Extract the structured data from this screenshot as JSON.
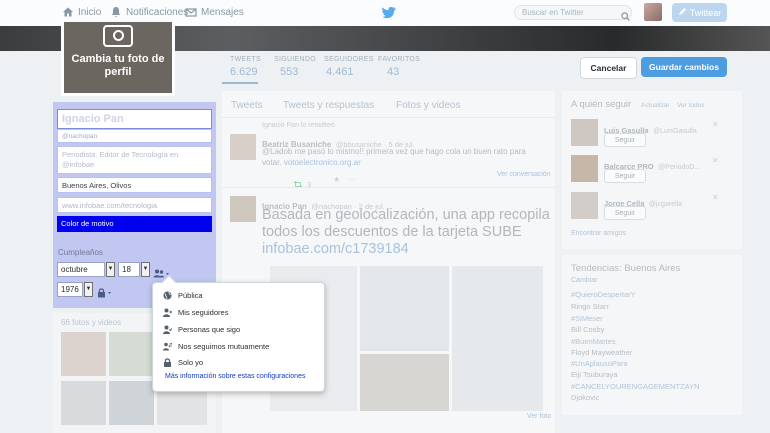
{
  "nav": {
    "home": "Inicio",
    "notifications": "Notificaciones",
    "messages": "Mensajes",
    "search_placeholder": "Buscar en Twitter",
    "tweet_button": "Twittear"
  },
  "avatar": {
    "change_photo": "Cambia tu foto de perfil"
  },
  "stats": [
    {
      "label": "TWEETS",
      "value": "6.629"
    },
    {
      "label": "SIGUIENDO",
      "value": "553"
    },
    {
      "label": "SEGUIDORES",
      "value": "4.461"
    },
    {
      "label": "FAVORITOS",
      "value": "43"
    }
  ],
  "actions": {
    "cancel": "Cancelar",
    "save": "Guardar cambios"
  },
  "profile_edit": {
    "name": "Ignacio Pan",
    "handle": "@nachopan",
    "bio": "Periodista. Editor de Tecnología en @infobae",
    "location": "Buenos Aires, Olivos",
    "website": "www.infobae.com/tecnologia",
    "theme_color_label": "Color de motivo",
    "theme_color": "#0000ee",
    "birthday_label": "Cumpleaños",
    "birth_month": "octubre",
    "birth_day": "18",
    "birth_year": "1976"
  },
  "visibility_menu": {
    "items": [
      "Pública",
      "Mis seguidores",
      "Personas que sigo",
      "Nos seguimos mutuamente",
      "Solo yo"
    ],
    "more_link": "Más información sobre estas configuraciones"
  },
  "photos": {
    "title": "66 fotos y videos"
  },
  "timeline": {
    "tabs": [
      "Tweets",
      "Tweets y respuestas",
      "Fotos y videos"
    ],
    "retweet_note": "Ignacio Pan lo retwitteó",
    "tweet1": {
      "name": "Beatriz Busaniche",
      "handle": "@bbusaniche · 5 de jul.",
      "text": "@Ladob me pasó lo mismo!! primera vez que hago cola un buen rato para votar.",
      "link": "votoelectronico.org.ar",
      "retweets": "3",
      "view_conversation": "Ver conversación"
    },
    "tweet2": {
      "name": "Ignacio Pan",
      "handle": "@nachopan · 2 de jul.",
      "text": "Basada en geolocalización, una app recopila todos los descuentos de la tarjeta SUBE",
      "link": "infobae.com/c1739184",
      "view_photo": "Ver foto"
    }
  },
  "who_to_follow": {
    "title": "A quién seguir",
    "update": "Actualizar",
    "view_all": "Ver todos",
    "follow_label": "Seguir",
    "users": [
      {
        "name": "Luis Gasulla",
        "handle": "@LuisGasulla"
      },
      {
        "name": "Balcarce PRO",
        "handle": "@PeriodoD..."
      },
      {
        "name": "Jorge Cella",
        "handle": "@jcgarella"
      }
    ],
    "find_friends": "Encontrar amigos"
  },
  "trends": {
    "title": "Tendencias: Buenos Aires",
    "change": "Cambiar",
    "items": [
      "#QuieroDespertarY",
      "Ringo Starr",
      "#SiMeser",
      "Bill Cosby",
      "#BuenMartes",
      "Floyd Mayweather",
      "#UnAplausoPara",
      "Eiji Tsuburaya",
      "#CANCELYOURENGAGEMENTZAYN",
      "Djokovic"
    ]
  },
  "colors": {
    "accent": "#4d9de0",
    "edit_panel": "#c2c7f2",
    "link": "#0f3bc2"
  }
}
